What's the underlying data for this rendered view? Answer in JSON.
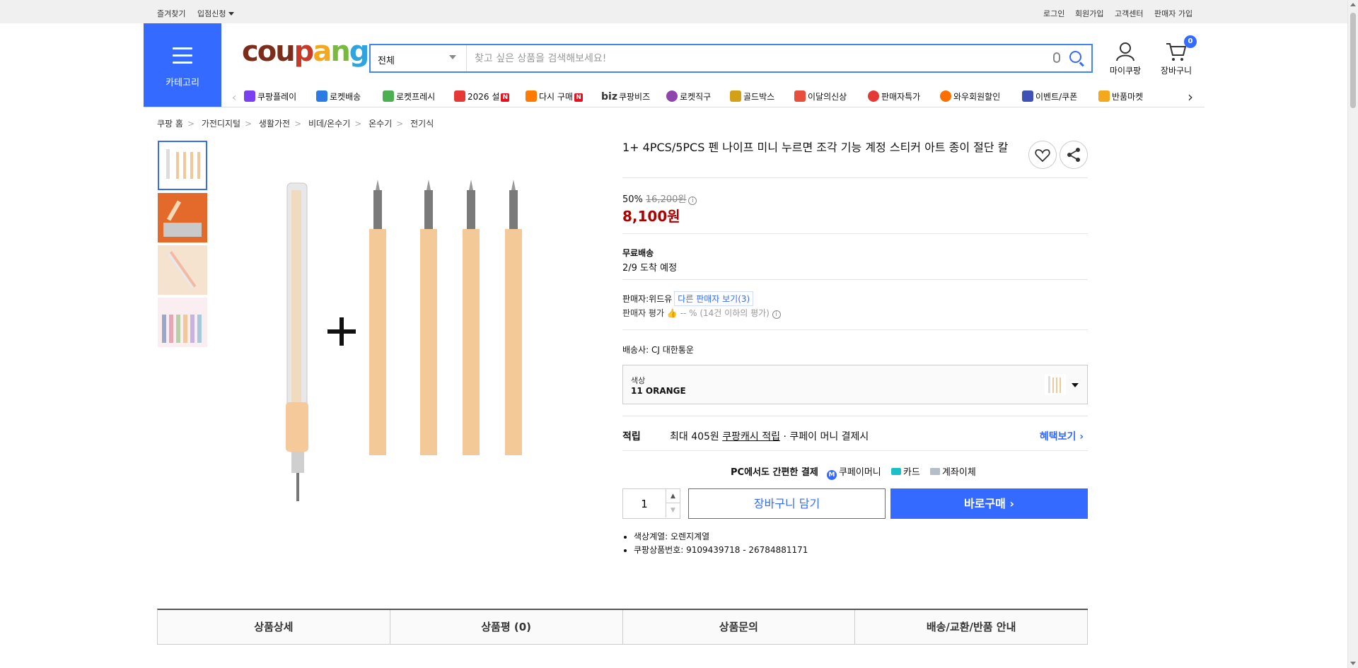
{
  "top_links": {
    "bookmark": "즐겨찾기",
    "seller_apply": "입점신청",
    "login": "로그인",
    "signup": "회원가입",
    "support": "고객센터",
    "seller_signup": "판매자 가입"
  },
  "header": {
    "category_label": "카테고리",
    "logo_parts": [
      "cou",
      "p",
      "a",
      "n",
      "g"
    ],
    "search_scope": "전체",
    "search_placeholder": "찾고 싶은 상품을 검색해보세요!",
    "mycoupang": "마이쿠팡",
    "cart_label": "장바구니",
    "cart_count": "0"
  },
  "menu": [
    {
      "label": "쿠팡플레이",
      "color": "#7b3ff2",
      "new": false
    },
    {
      "label": "로켓배송",
      "color": "#2a7be4",
      "new": false
    },
    {
      "label": "로켓프레시",
      "color": "#4caf50",
      "new": false
    },
    {
      "label": "2026 설",
      "color": "#e53935",
      "new": true
    },
    {
      "label": "다시 구매",
      "color": "#ff7a00",
      "new": true
    },
    {
      "label": "쿠팡비즈",
      "color": "#222222",
      "new": false
    },
    {
      "label": "로켓직구",
      "color": "#8e44ad",
      "new": false
    },
    {
      "label": "골드박스",
      "color": "#d4a017",
      "new": false
    },
    {
      "label": "이달의신상",
      "color": "#e94e3c",
      "new": false
    },
    {
      "label": "판매자특가",
      "color": "#e53935",
      "new": false
    },
    {
      "label": "와우회원할인",
      "color": "#ff6f00",
      "new": false
    },
    {
      "label": "이벤트/쿠폰",
      "color": "#3f51b5",
      "new": false
    },
    {
      "label": "반품마켓",
      "color": "#f4a81e",
      "new": false
    }
  ],
  "breadcrumb": [
    "쿠팡 홈",
    "가전디지털",
    "생활가전",
    "비데/온수기",
    "온수기",
    "전기식"
  ],
  "product": {
    "title": "1+ 4PCS/5PCS 펜 나이프 미니 누르면 조각 기능 계정 스티커 아트 종이 절단 칼",
    "discount": "50%",
    "original_price": "16,200원",
    "price": "8,100원",
    "shipping_title": "무료배송",
    "arrival": "2/9 도착 예정",
    "seller_label": "판매자:",
    "seller_name": "위드유",
    "other_sellers": "다른 판매자 보기(3)",
    "rating_label": "판매자 평가",
    "rating_value": "-- %",
    "rating_note": "(14건 이하의 평가)",
    "courier_label": "배송사:",
    "courier": "CJ 대한통운",
    "option_label": "색상",
    "option_value": "11 ORANGE",
    "reward_key": "적립",
    "reward_prefix": "최대 405원",
    "reward_link": "쿠팡캐시 적립",
    "reward_suffix": "· 쿠페이 머니 결제시",
    "reward_more": "혜택보기",
    "pay_title": "PC에서도 간편한 결제",
    "pay_money": "쿠페이머니",
    "pay_card": "카드",
    "pay_bank": "계좌이체",
    "quantity": "1",
    "add_cart": "장바구니 담기",
    "buy_now": "바로구매",
    "spec_color": "색상계열: 오렌지계열",
    "spec_id": "쿠팡상품번호: 9109439718 - 26784881171"
  },
  "tabs": [
    "상품상세",
    "상품평 (0)",
    "상품문의",
    "배송/교환/반품 안내"
  ],
  "colors": {
    "accent": "#346aff",
    "price": "#ae0000"
  }
}
